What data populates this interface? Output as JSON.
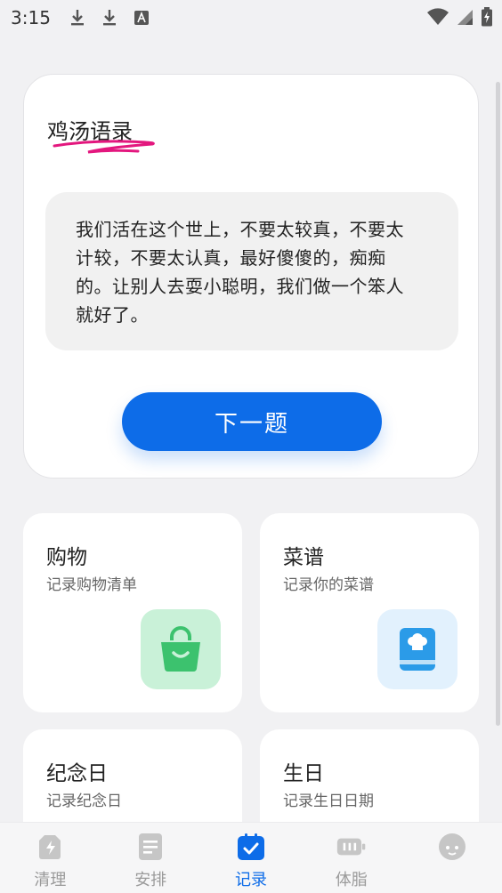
{
  "status_bar": {
    "time": "3:15",
    "icons": [
      "download-icon",
      "download-icon",
      "text-a-icon",
      "wifi-icon",
      "signal-icon",
      "battery-charging-icon"
    ]
  },
  "quote_card": {
    "title": "鸡汤语录",
    "lines": [
      "我们活在这个世上，不要太较真，不要太",
      "计较，不要太认真，最好傻傻的，痴痴",
      "的。让别人去耍小聪明，我们做一个笨人",
      "就好了。"
    ],
    "next_label": "下一题"
  },
  "cards": [
    {
      "title": "购物",
      "subtitle": "记录购物清单",
      "icon": "shopping-bag-icon",
      "icon_bg": "#c9f1d8",
      "icon_color": "#3cc26e"
    },
    {
      "title": "菜谱",
      "subtitle": "记录你的菜谱",
      "icon": "recipe-book-icon",
      "icon_bg": "#e2f1fd",
      "icon_color": "#2b9be8"
    },
    {
      "title": "纪念日",
      "subtitle": "记录纪念日"
    },
    {
      "title": "生日",
      "subtitle": "记录生日日期"
    }
  ],
  "nav": {
    "items": [
      {
        "label": "清理",
        "icon": "clean-icon"
      },
      {
        "label": "安排",
        "icon": "document-icon"
      },
      {
        "label": "记录",
        "icon": "calendar-check-icon",
        "active": true
      },
      {
        "label": "体脂",
        "icon": "scale-icon"
      },
      {
        "label": "",
        "icon": "avatar-icon"
      }
    ],
    "active_color": "#0d6ce8",
    "inactive_color": "#bdbdbd"
  },
  "colors": {
    "accent": "#0d6ce8",
    "underline": "#e3177e"
  }
}
